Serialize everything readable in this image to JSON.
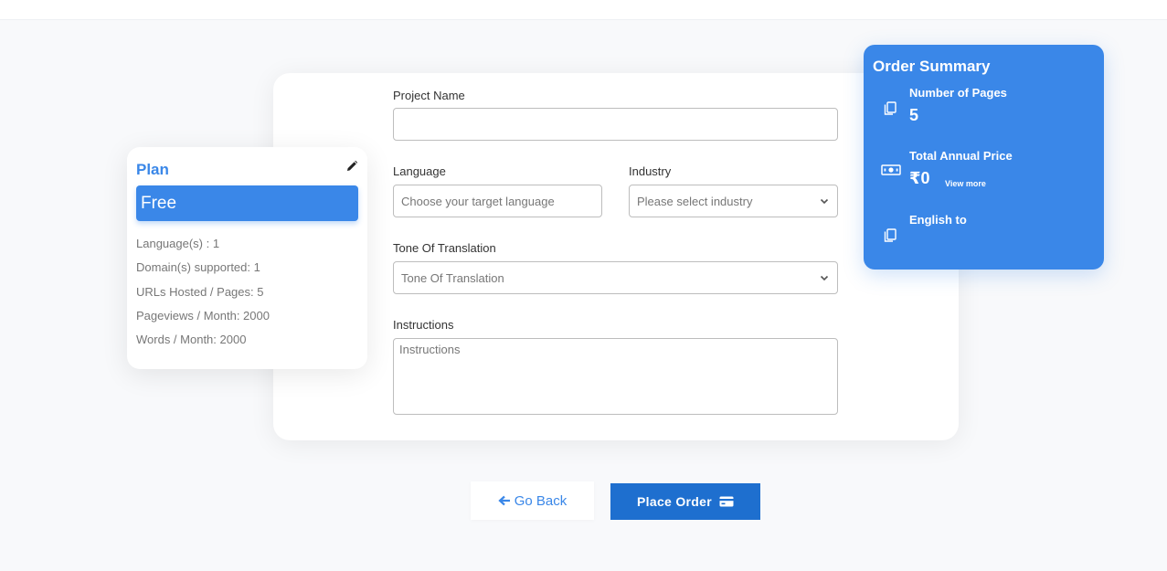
{
  "form": {
    "project_name": {
      "label": "Project Name",
      "value": ""
    },
    "language": {
      "label": "Language",
      "placeholder": "Choose your target language"
    },
    "industry": {
      "label": "Industry",
      "placeholder": "Please select industry"
    },
    "tone": {
      "label": "Tone Of Translation",
      "placeholder": "Tone Of Translation"
    },
    "instructions": {
      "label": "Instructions",
      "placeholder": "Instructions"
    }
  },
  "plan": {
    "title": "Plan",
    "name": "Free",
    "features": [
      "Language(s) : 1",
      "Domain(s) supported: 1",
      "URLs Hosted / Pages: 5",
      "Pageviews / Month: 2000",
      "Words / Month: 2000"
    ]
  },
  "summary": {
    "title": "Order Summary",
    "pages_label": "Number of Pages",
    "pages_value": "5",
    "price_label": "Total Annual Price",
    "price_value": "₹0",
    "view_more": "View more",
    "language_label": "English to"
  },
  "actions": {
    "back": "Go Back",
    "order": "Place Order"
  },
  "colors": {
    "accent": "#3a87e8",
    "button": "#1e6fcf",
    "background": "#f8f9fb"
  }
}
